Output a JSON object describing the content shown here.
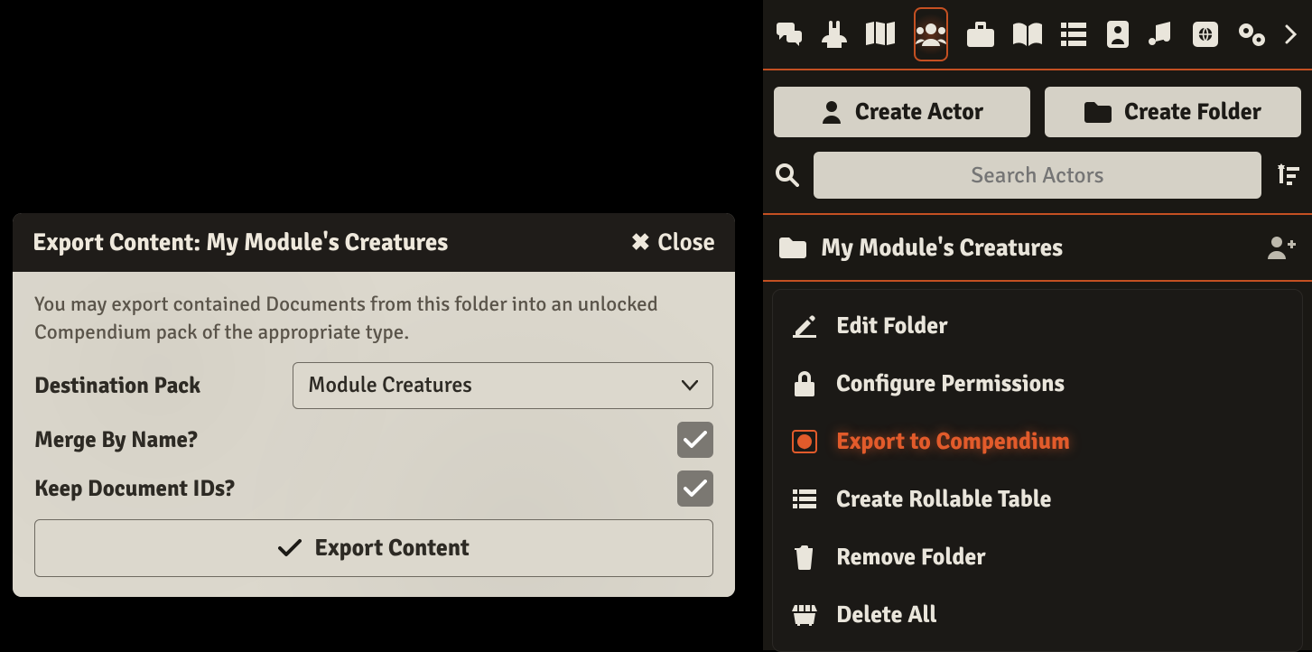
{
  "dialog": {
    "title": "Export Content: My Module's Creatures",
    "close_label": "Close",
    "hint": "You may export contained Documents from this folder into an unlocked Compendium pack of the appropriate type.",
    "destination_label": "Destination Pack",
    "destination_value": "Module Creatures",
    "merge_label": "Merge By Name?",
    "merge_checked": true,
    "keep_ids_label": "Keep Document IDs?",
    "keep_ids_checked": true,
    "export_label": "Export Content"
  },
  "sidebar": {
    "tabs": [
      "chat",
      "combat",
      "scenes",
      "actors",
      "items",
      "journal",
      "tables",
      "cards",
      "playlists",
      "compendium",
      "settings"
    ],
    "active_tab": "actors",
    "create_actor_label": "Create Actor",
    "create_folder_label": "Create Folder",
    "search_placeholder": "Search Actors",
    "folder_name": "My Module's Creatures",
    "context_menu": [
      {
        "icon": "edit",
        "label": "Edit Folder"
      },
      {
        "icon": "lock",
        "label": "Configure Permissions"
      },
      {
        "icon": "atlas",
        "label": "Export to Compendium",
        "highlight": true
      },
      {
        "icon": "table",
        "label": "Create Rollable Table"
      },
      {
        "icon": "trash",
        "label": "Remove Folder"
      },
      {
        "icon": "dumpster",
        "label": "Delete All"
      }
    ]
  }
}
